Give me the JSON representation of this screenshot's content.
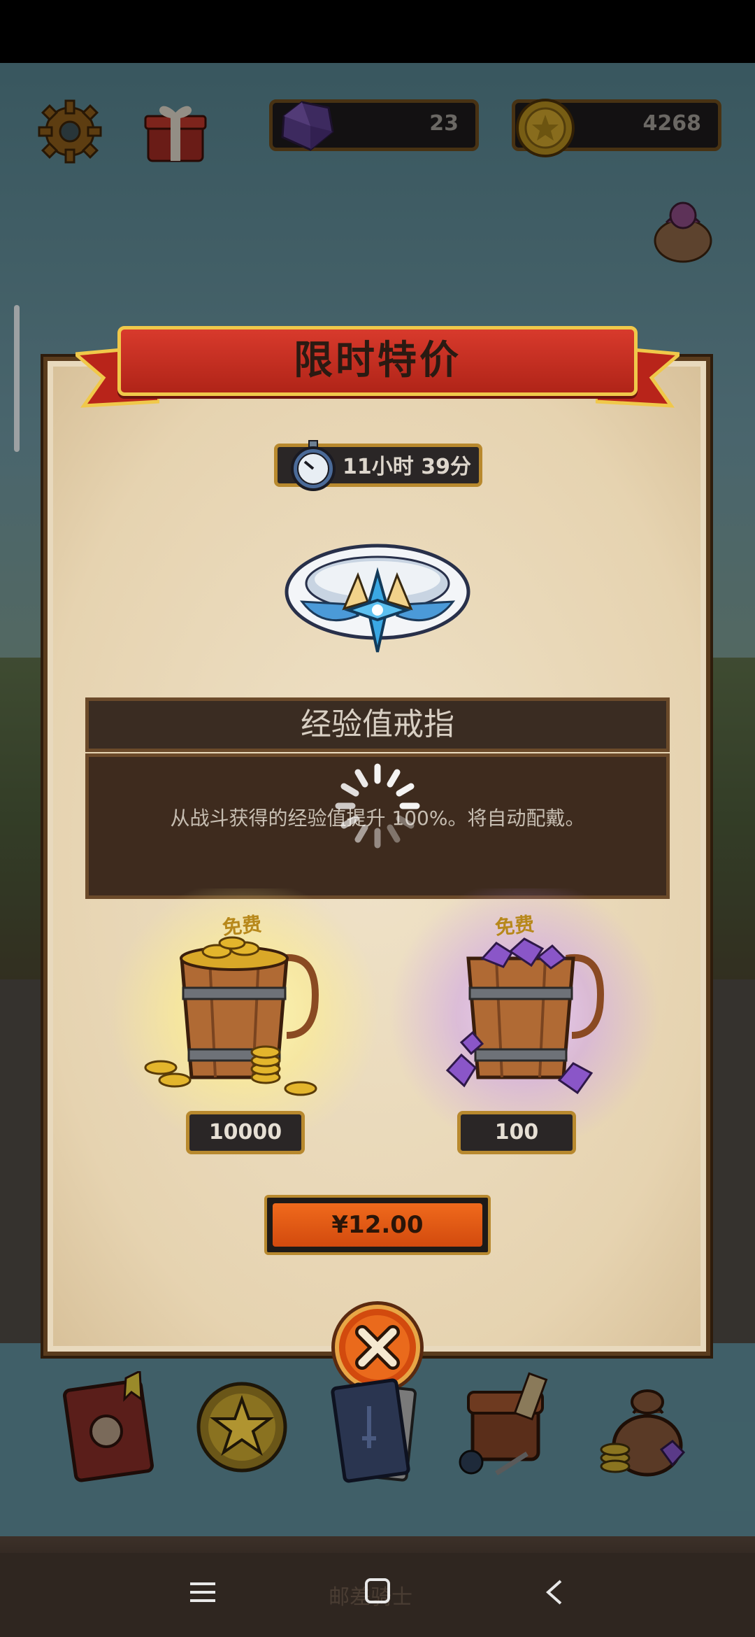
{
  "hud": {
    "gems": "23",
    "coins": "4268",
    "icons": [
      "gear-icon",
      "gift-icon",
      "gem-icon",
      "coin-icon",
      "sack-icon"
    ]
  },
  "popup": {
    "title": "限时特价",
    "timer": "11小时 39分",
    "item_name": "经验值戒指",
    "item_desc": "从战斗获得的经验值提升 100%。将自动配戴。",
    "rewards": [
      {
        "tag": "免费",
        "amount": "10000",
        "kind": "coin-bucket"
      },
      {
        "tag": "免费",
        "amount": "100",
        "kind": "gem-bucket"
      }
    ],
    "price": "¥12.00"
  },
  "bottom_nav": [
    "book-icon",
    "star-coin-icon",
    "card-icon",
    "backpack-icon",
    "money-sack-icon"
  ],
  "system_nav": {
    "app_name": "邮差骑士"
  },
  "colors": {
    "ribbon": "#c42e20",
    "panel": "#e8d9bd",
    "price_button": "#e45a14",
    "box_dark": "#3e2b1e"
  }
}
